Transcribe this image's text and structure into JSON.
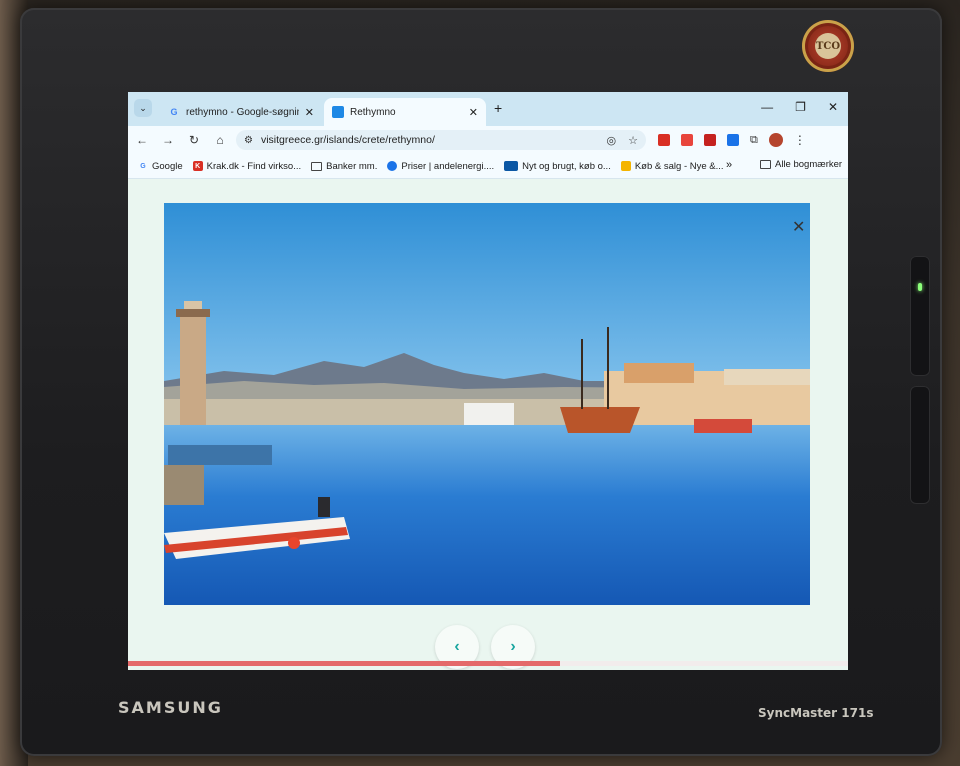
{
  "monitor": {
    "brand": "SAMSUNG",
    "model": "SyncMaster 171s"
  },
  "browser": {
    "tabs": [
      {
        "title": "rethymno - Google-søgning",
        "active": false,
        "favicon": "google-icon"
      },
      {
        "title": "Rethymno",
        "active": true,
        "favicon": "site-icon"
      }
    ],
    "url": "visitgreece.gr/islands/crete/rethymno/",
    "bookmarks": [
      {
        "label": "Google",
        "icon": "google-icon",
        "color": "#4285f4"
      },
      {
        "label": "Krak.dk - Find virkso...",
        "icon": "krak-icon",
        "color": "#d93025"
      },
      {
        "label": "Banker mm.",
        "icon": "folder-icon",
        "color": "#444444"
      },
      {
        "label": "Priser | andelenergi....",
        "icon": "andel-icon",
        "color": "#1a73e8"
      },
      {
        "label": "Nyt og brugt, køb o...",
        "icon": "dba-icon",
        "color": "#0b57a4"
      },
      {
        "label": "Køb & salg - Nye &...",
        "icon": "gg-icon",
        "color": "#f4b400"
      }
    ],
    "bookmarks_more": "»",
    "all_bookmarks": "Alle bogmærker"
  },
  "page": {
    "close_glyph": "✕",
    "prev_glyph": "‹",
    "next_glyph": "›",
    "slideshow_progress": 0.6,
    "accent_color": "#1aa6a0"
  }
}
